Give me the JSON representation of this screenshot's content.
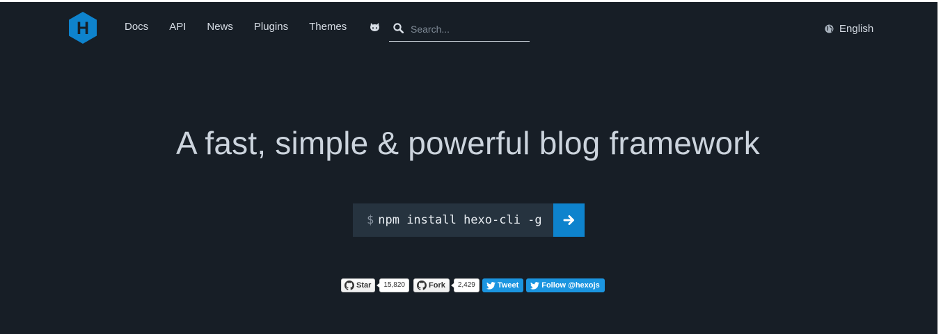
{
  "header": {
    "logo_letter": "H",
    "nav": [
      {
        "label": "Docs"
      },
      {
        "label": "API"
      },
      {
        "label": "News"
      },
      {
        "label": "Plugins"
      },
      {
        "label": "Themes"
      }
    ],
    "github_icon": "github-cat-icon",
    "search": {
      "icon": "search-icon",
      "placeholder": "Search...",
      "value": ""
    },
    "language": {
      "icon": "globe-icon",
      "label": "English"
    }
  },
  "hero": {
    "headline": "A fast, simple & powerful blog framework",
    "install": {
      "prompt": "$",
      "command": "npm install hexo-cli -g",
      "button_icon": "arrow-right-icon"
    }
  },
  "social": {
    "star": {
      "label": "Star",
      "count": "15,820"
    },
    "fork": {
      "label": "Fork",
      "count": "2,429"
    },
    "tweet": {
      "label": "Tweet"
    },
    "follow": {
      "label": "Follow @hexojs"
    }
  },
  "colors": {
    "background": "#171e26",
    "brand_blue": "#0e83cd",
    "code_background": "#26333f",
    "twitter_blue": "#1b95e0"
  }
}
